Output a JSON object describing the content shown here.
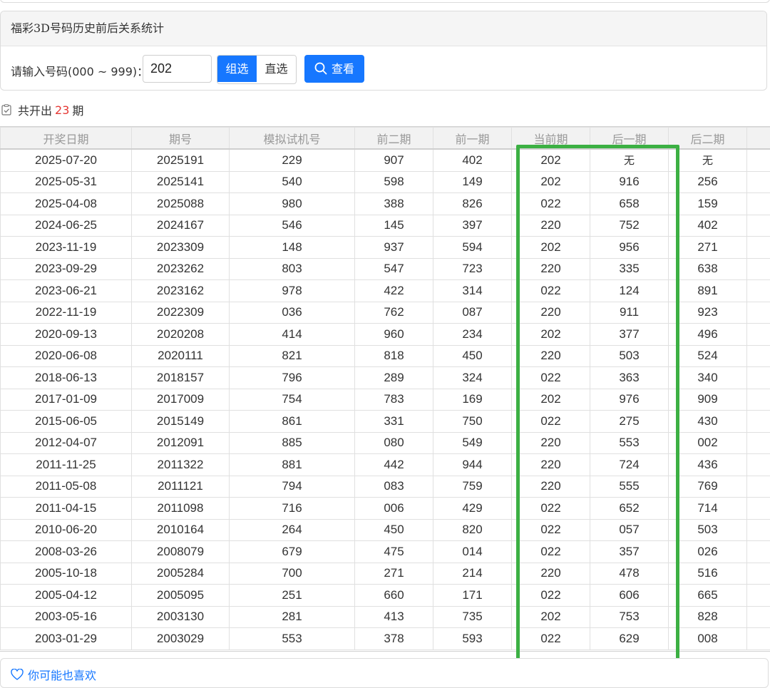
{
  "panel": {
    "title": "福彩3D号码历史前后关系统计"
  },
  "query": {
    "label": "请输入号码(000 ~ 999)：",
    "input_value": "202",
    "mode_group": "组选",
    "mode_direct": "直选",
    "view_label": "查看"
  },
  "summary": {
    "prefix": "共开出",
    "count": "23",
    "suffix": "期"
  },
  "table": {
    "headers": [
      "开奖日期",
      "期号",
      "模拟试机号",
      "前二期",
      "前一期",
      "当前期",
      "后一期",
      "后二期"
    ],
    "rows": [
      [
        "2025-07-20",
        "2025191",
        "229",
        "907",
        "402",
        "202",
        "无",
        "无"
      ],
      [
        "2025-05-31",
        "2025141",
        "540",
        "598",
        "149",
        "202",
        "916",
        "256"
      ],
      [
        "2025-04-08",
        "2025088",
        "980",
        "388",
        "826",
        "022",
        "658",
        "159"
      ],
      [
        "2024-06-25",
        "2024167",
        "546",
        "145",
        "397",
        "220",
        "752",
        "402"
      ],
      [
        "2023-11-19",
        "2023309",
        "148",
        "937",
        "594",
        "202",
        "956",
        "271"
      ],
      [
        "2023-09-29",
        "2023262",
        "803",
        "547",
        "723",
        "220",
        "335",
        "638"
      ],
      [
        "2023-06-21",
        "2023162",
        "978",
        "422",
        "314",
        "022",
        "124",
        "891"
      ],
      [
        "2022-11-19",
        "2022309",
        "036",
        "762",
        "087",
        "220",
        "911",
        "923"
      ],
      [
        "2020-09-13",
        "2020208",
        "414",
        "960",
        "234",
        "202",
        "377",
        "496"
      ],
      [
        "2020-06-08",
        "2020111",
        "821",
        "818",
        "450",
        "220",
        "503",
        "524"
      ],
      [
        "2018-06-13",
        "2018157",
        "796",
        "289",
        "324",
        "022",
        "363",
        "340"
      ],
      [
        "2017-01-09",
        "2017009",
        "754",
        "783",
        "169",
        "202",
        "976",
        "909"
      ],
      [
        "2015-06-05",
        "2015149",
        "861",
        "331",
        "750",
        "022",
        "275",
        "430"
      ],
      [
        "2012-04-07",
        "2012091",
        "885",
        "080",
        "549",
        "220",
        "553",
        "002"
      ],
      [
        "2011-11-25",
        "2011322",
        "881",
        "442",
        "944",
        "220",
        "724",
        "436"
      ],
      [
        "2011-05-08",
        "2011121",
        "794",
        "083",
        "759",
        "220",
        "555",
        "769"
      ],
      [
        "2011-04-15",
        "2011098",
        "716",
        "006",
        "429",
        "022",
        "652",
        "714"
      ],
      [
        "2010-06-20",
        "2010164",
        "264",
        "450",
        "820",
        "022",
        "057",
        "503"
      ],
      [
        "2008-03-26",
        "2008079",
        "679",
        "475",
        "014",
        "022",
        "357",
        "026"
      ],
      [
        "2005-10-18",
        "2005284",
        "700",
        "271",
        "214",
        "220",
        "478",
        "516"
      ],
      [
        "2005-04-12",
        "2005095",
        "251",
        "660",
        "171",
        "022",
        "606",
        "665"
      ],
      [
        "2003-05-16",
        "2003130",
        "281",
        "413",
        "735",
        "202",
        "753",
        "828"
      ],
      [
        "2003-01-29",
        "2003029",
        "553",
        "378",
        "593",
        "022",
        "629",
        "008"
      ]
    ]
  },
  "recommend": {
    "label": "你可能也喜欢"
  },
  "colors": {
    "accent": "#1677ff",
    "count": "#e53935",
    "highlight": "#3cb043"
  }
}
